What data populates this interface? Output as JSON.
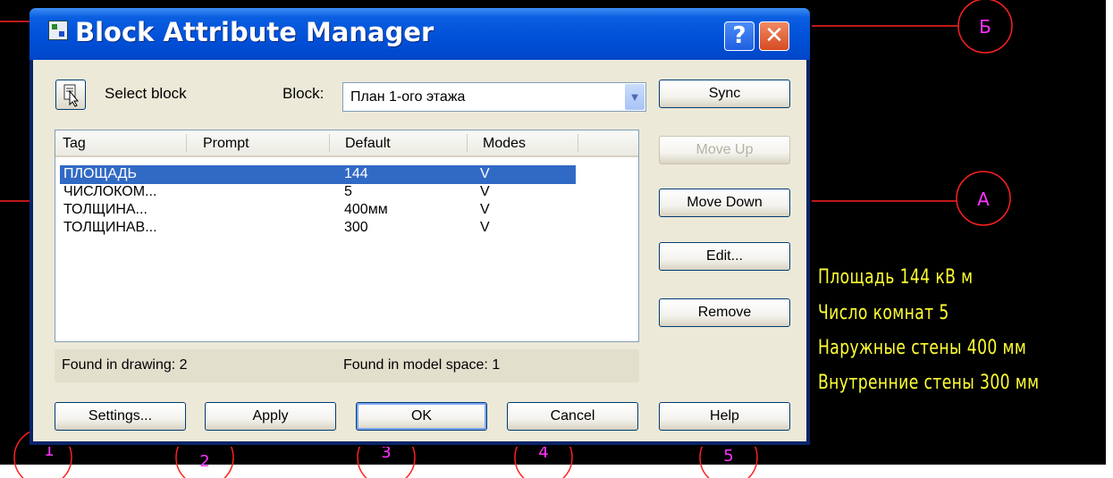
{
  "dialog": {
    "title": "Block Attribute Manager",
    "help_glyph": "?",
    "close_glyph": "✕",
    "select_block_label": "Select block",
    "block_label": "Block:",
    "block_value": "План 1-ого этажа",
    "combo_arrow": "▼",
    "columns": {
      "tag": "Tag",
      "prompt": "Prompt",
      "default": "Default",
      "modes": "Modes"
    },
    "rows": [
      {
        "tag": "ПЛОЩАДЬ",
        "default": "144",
        "modes": "V",
        "selected": true
      },
      {
        "tag": "ЧИСЛОКОМ...",
        "default": "5",
        "modes": "V"
      },
      {
        "tag": "ТОЛЩИНА...",
        "default": "400мм",
        "modes": "V"
      },
      {
        "tag": "ТОЛЩИНАВ...",
        "default": "300",
        "modes": "V"
      }
    ],
    "found_in_drawing": "Found in drawing: 2",
    "found_in_model_space": "Found in model space: 1",
    "side_buttons": {
      "sync": "Sync",
      "move_up": "Move Up",
      "move_down": "Move Down",
      "edit": "Edit...",
      "remove": "Remove"
    },
    "bottom_buttons": {
      "settings": "Settings...",
      "apply": "Apply",
      "ok": "OK",
      "cancel": "Cancel",
      "help": "Help"
    }
  },
  "drawing": {
    "grid_labels": [
      "Б",
      "А",
      "1",
      "2",
      "3",
      "4",
      "5"
    ],
    "attribute_text": [
      "Площадь 144 кВ м",
      "Число комнат 5",
      "Наружные стены 400 мм",
      "Внутренние стены 300 мм"
    ]
  },
  "colors": {
    "canvas": "#000000",
    "axis_lines": "#ff2020",
    "grid_labels": "#ff33ff",
    "attribute_text": "#ffff33",
    "titlebar": "#0054e3",
    "selection": "#316ac5"
  }
}
